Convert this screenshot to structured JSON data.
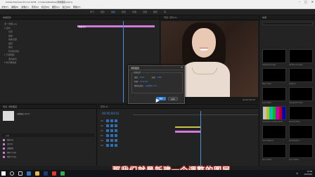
{
  "window": {
    "title": "Adobe Premiere Pro CC 2018 - C:\\Users\\Desktop\\调整图层.prproj"
  },
  "menu": {
    "items": [
      "文件(F)",
      "编辑(E)",
      "剪辑(C)",
      "序列(S)",
      "标记(M)",
      "图形(G)",
      "窗口(W)",
      "帮助(H)"
    ]
  },
  "workspace": {
    "tabs": [
      "学习",
      "组件",
      "编辑",
      "颜色",
      "效果",
      "音频",
      "图形",
      "库"
    ],
    "active_index": 2
  },
  "effect_controls": {
    "header": "效果控件",
    "rows": [
      "源 * 杨幂.jpg",
      "▾ 运动",
      "位置",
      "缩放",
      "缩放宽度",
      "旋转",
      "锚点",
      "防闪烁滤镜",
      "▾ 不透明度",
      "混合模式",
      "▾ 时间重映射"
    ],
    "clip_label": "杨幂.jpg"
  },
  "program_monitor": {
    "header": "节目: 序列 01",
    "timecode": "00:00:00:01",
    "duration": "00:00:05:00"
  },
  "dialog": {
    "title": "调整图层",
    "close": "✕",
    "group_label": "视频设置",
    "width_label": "宽度:",
    "width_value": "1920",
    "height_label": "高度:",
    "height_value": "1080",
    "timebase_label": "时基:",
    "timebase_value": "25.00 fps",
    "par_label": "像素长宽比:",
    "par_value": "方形像素 (1.0)",
    "ok_label": "确定",
    "cancel_label": "取消"
  },
  "project": {
    "header": "项目: 调整图层",
    "project_name": "调整图层.prproj",
    "column_header": "名称",
    "items": [
      "杨幂.jpg",
      "序列 01",
      "调整图层",
      "杨幂 (1).jpg",
      "杨幂 (2).jpg"
    ],
    "item_color": "#c87ad8"
  },
  "timeline": {
    "header": "序列 01",
    "timecode": "00:00:00:01",
    "tracks": [
      "V3",
      "V2",
      "V1",
      "A1",
      "A2",
      "A3"
    ]
  },
  "effects_panel": {
    "header": "效果",
    "thumbnails": [
      {
        "label": "Adjustment Layer",
        "style": "black"
      },
      {
        "label": "HD Bars and Tone",
        "style": "black"
      },
      {
        "label": "Black Video",
        "style": "black"
      },
      {
        "label": "Captions",
        "style": "black"
      },
      {
        "label": "Color Matte",
        "style": "black"
      },
      {
        "label": "Transparent Video",
        "style": "black"
      },
      {
        "label": "Universal Counting Leader",
        "style": "bars"
      },
      {
        "label": "Bars and Tone",
        "style": "black"
      },
      {
        "label": "Cross Dissolve",
        "style": "black"
      },
      {
        "label": "Film Dissolve",
        "style": "black"
      },
      {
        "label": "Dip to Black",
        "style": "black"
      },
      {
        "label": "Dip to White",
        "style": "black"
      }
    ]
  },
  "subtitle": "那我们就是新建一个调整的图层",
  "taskbar": {
    "time": "16:08",
    "date": "2018/6/6",
    "lang": "中"
  }
}
